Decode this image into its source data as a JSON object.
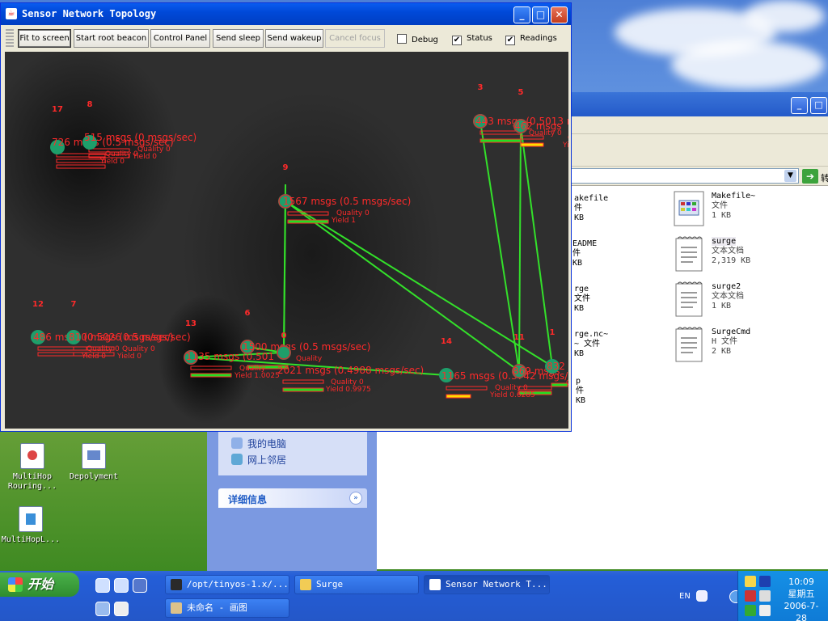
{
  "sensor_window": {
    "title": "Sensor Network Topology",
    "buttons": {
      "fit_to_screen": "Fit to screen",
      "start_root_beacon": "Start root beacon",
      "control_panel": "Control Panel",
      "send_sleep": "Send sleep",
      "send_wakeup": "Send wakeup",
      "cancel_focus": "Cancel focus"
    },
    "checkboxes": {
      "debug": {
        "label": "Debug",
        "checked": false
      },
      "status": {
        "label": "Status",
        "checked": true
      },
      "readings": {
        "label": "Readings",
        "checked": true
      }
    }
  },
  "topology": {
    "colors": {
      "node": "#1e9e6a",
      "link": "#33e02a",
      "label": "#ff2a2a",
      "bar_good": "#22dd22",
      "bar_warn": "#ffdd00"
    },
    "nodes": [
      {
        "id": "17",
        "stats": "726 msgs (0.5 msgs/sec)",
        "quality": "Quality 0",
        "yield": "Yield 0"
      },
      {
        "id": "8",
        "stats": "515 msgs (0 msgs/sec)",
        "quality": "Quality 0",
        "yield": "Yield 0"
      },
      {
        "id": "3",
        "stats": "443 msgs (0.5013 m",
        "quality": "Quality 0",
        "yield": ""
      },
      {
        "id": "5",
        "stats": "462 msgs",
        "quality": "Quality",
        "yield": "Yield 1.025"
      },
      {
        "id": "9",
        "stats": "1567 msgs (0.5 msgs/sec)",
        "quality": "Quality 0",
        "yield": "Yield 1"
      },
      {
        "id": "12",
        "stats": "486 msgs (0.5026 msgs/sec)",
        "quality": "Quality 0",
        "yield": "Yield 0"
      },
      {
        "id": "7",
        "stats": "810 msgs (0.5 msgs/sec)",
        "quality": "Quality 0",
        "yield": "Yield 0"
      },
      {
        "id": "13",
        "stats": "1135 msgs (0.501",
        "quality": "Quality",
        "yield": "Yield 1.0025"
      },
      {
        "id": "6",
        "stats": "1500 msgs (0.5 msgs/sec)",
        "quality": "Quality",
        "yield": ""
      },
      {
        "id": "0",
        "stats": "2021 msgs (0.4988 msgs/sec)",
        "quality": "Quality 0",
        "yield": "Yield 0.9975"
      },
      {
        "id": "14",
        "stats": "1165 msgs (0.3742 msgs/sec)",
        "quality": "Quality 0",
        "yield": "Yield 0.6285"
      },
      {
        "id": "11",
        "stats": "869 msgs",
        "quality": "Quality",
        "yield": ""
      },
      {
        "id": "1",
        "stats": "832",
        "quality": "",
        "yield": ""
      }
    ]
  },
  "explorer": {
    "address_go": "转",
    "files": [
      {
        "name": "Makefile",
        "type": "文件",
        "size": "1 KB"
      },
      {
        "name": "Makefile~",
        "type": "文件",
        "size": "1 KB"
      },
      {
        "name": "README",
        "type": "文件",
        "size": "1 KB"
      },
      {
        "name": "surge",
        "type": "文本文档",
        "size": "2,319 KB"
      },
      {
        "name": "surge",
        "type": "文件",
        "size": "1 KB"
      },
      {
        "name": "surge2",
        "type": "文本文档",
        "size": "1 KB"
      },
      {
        "name": "Surge.nc~",
        "type": "NC~ 文件",
        "size": "1 KB"
      },
      {
        "name": "SurgeCmd",
        "type": "H 文件",
        "size": "2 KB"
      },
      {
        "name": "p",
        "type": "文件",
        "size": "1 KB"
      }
    ],
    "left_files_visible": [
      "akefile",
      "件",
      "KB",
      "EADME",
      "件",
      "KB",
      "rge",
      "文件",
      "KB",
      "rge.nc~",
      "~ 文件",
      "KB",
      "p",
      "件",
      "KB"
    ],
    "tasks": {
      "my_computer": "我的电脑",
      "network": "网上邻居"
    },
    "details": "详细信息"
  },
  "desktop_icons": [
    {
      "label1": "MultiHop",
      "label2": "Rouring..."
    },
    {
      "label1": "Depolyment",
      "label2": ""
    },
    {
      "label1": "MultiHopL...",
      "label2": ""
    }
  ],
  "taskbar": {
    "start": "开始",
    "tasks": [
      {
        "label": "/opt/tinyos-1.x/..."
      },
      {
        "label": "Surge"
      },
      {
        "label": "Sensor Network T..."
      },
      {
        "label": "未命名 - 画图"
      }
    ],
    "lang": "EN",
    "time": "10:09",
    "weekday": "星期五",
    "date": "2006-7-28"
  }
}
